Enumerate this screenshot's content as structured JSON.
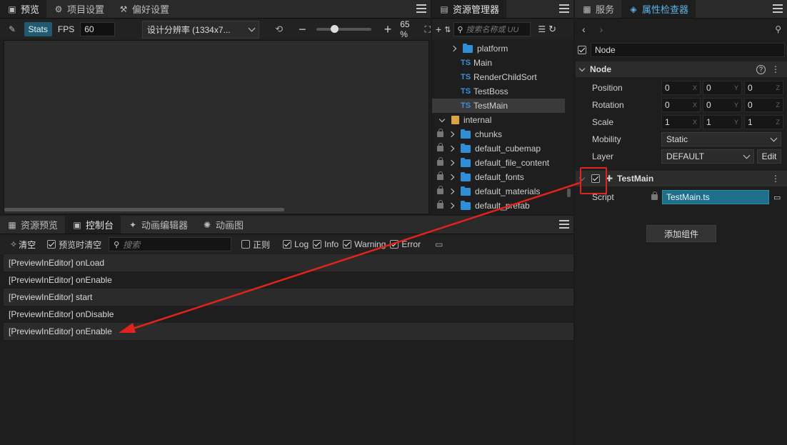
{
  "scene": {
    "tabs": [
      {
        "label": "预览"
      },
      {
        "label": "项目设置"
      },
      {
        "label": "偏好设置"
      }
    ],
    "toolbar": {
      "stats_label": "Stats",
      "fps_label": "FPS",
      "fps_value": "60",
      "resolution_label": "设计分辨率 (1334x7...",
      "zoom_label": "65 %"
    }
  },
  "assets": {
    "tab_label": "资源管理器",
    "search_placeholder": "搜索名称或 UU",
    "tree": [
      {
        "label": "platform",
        "kind": "folder"
      },
      {
        "label": "Main",
        "kind": "ts"
      },
      {
        "label": "RenderChildSort",
        "kind": "ts"
      },
      {
        "label": "TestBoss",
        "kind": "ts"
      },
      {
        "label": "TestMain",
        "kind": "ts"
      },
      {
        "label": "internal",
        "kind": "db"
      },
      {
        "label": "chunks",
        "kind": "folder"
      },
      {
        "label": "default_cubemap",
        "kind": "folder"
      },
      {
        "label": "default_file_content",
        "kind": "folder"
      },
      {
        "label": "default_fonts",
        "kind": "folder"
      },
      {
        "label": "default_materials",
        "kind": "folder"
      },
      {
        "label": "default_prefab",
        "kind": "folder"
      }
    ]
  },
  "console": {
    "tabs": [
      {
        "label": "资源预览"
      },
      {
        "label": "控制台"
      },
      {
        "label": "动画编辑器"
      },
      {
        "label": "动画图"
      }
    ],
    "clear_label": "清空",
    "clear_on_preview_label": "预览时清空",
    "search_placeholder": "搜索",
    "filters": {
      "regex": "正则",
      "log": "Log",
      "info": "Info",
      "warning": "Warning",
      "error": "Error"
    },
    "logs": [
      "[PreviewInEditor] onLoad",
      "[PreviewInEditor] onEnable",
      "[PreviewInEditor] start",
      "[PreviewInEditor] onDisable",
      "[PreviewInEditor] onEnable"
    ]
  },
  "inspector": {
    "tabs": [
      {
        "label": "服务"
      },
      {
        "label": "属性检查器"
      }
    ],
    "node_name": "Node",
    "node_section": "Node",
    "props": {
      "position": {
        "label": "Position",
        "x": "0",
        "y": "0",
        "z": "0"
      },
      "rotation": {
        "label": "Rotation",
        "x": "0",
        "y": "0",
        "z": "0"
      },
      "scale": {
        "label": "Scale",
        "x": "1",
        "y": "1",
        "z": "1"
      },
      "mobility": {
        "label": "Mobility",
        "value": "Static"
      },
      "layer": {
        "label": "Layer",
        "value": "DEFAULT",
        "edit": "Edit"
      }
    },
    "axis": {
      "x": "X",
      "y": "Y",
      "z": "Z"
    },
    "component": {
      "name": "TestMain",
      "script_label": "Script",
      "script_value": "TestMain.ts"
    },
    "add_component_label": "添加组件"
  },
  "colors": {
    "accent": "#1f5a70",
    "highlight_box": "#e0231c",
    "annotation_arrow": "#e0231c",
    "folder": "#2f8fd6"
  }
}
